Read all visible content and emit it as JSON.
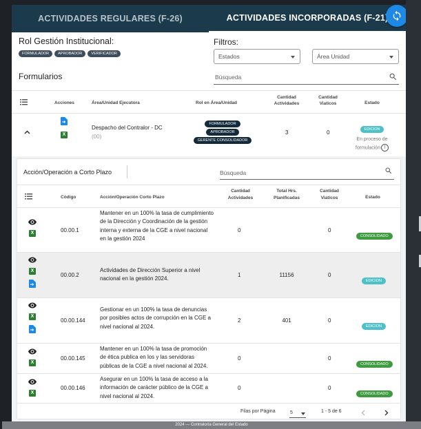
{
  "tabs": {
    "regular": "ACTIVIDADES REGULARES (F-26)",
    "incorporated": "ACTIVIDADES INCORPORADAS (F-21)"
  },
  "rol": {
    "title": "Rol Gestión Institucional:",
    "chips": [
      "FORMULADOR",
      "APROBADOR",
      "VERIFICADOR"
    ]
  },
  "formularios_label": "Formularios",
  "filtros": {
    "title": "Filtros:",
    "estados_placeholder": "Estados",
    "area_placeholder": "Área Unidad",
    "search_placeholder": "Búsqueda"
  },
  "table1": {
    "headers": {
      "acciones": "Acciones",
      "area": "Área/Unidad Ejecutora",
      "rol": "Rol en Área/Unidad",
      "cant_act_1": "Cantidad",
      "cant_act_2": "Actividades",
      "cant_via_1": "Cantidad",
      "cant_via_2": "Viaticos",
      "estado": "Estado"
    },
    "row": {
      "area": "Despacho del Contralor - DC",
      "code": "(00)",
      "roles": [
        "FORMULADOR",
        "APROBADOR",
        "GERENTE CONSOLIDADOR"
      ],
      "cantidad_actividades": "3",
      "cantidad_viaticos": "0",
      "estado_badge": "EDICION",
      "estado_line1": "En proceso de",
      "estado_line2": "formulación"
    }
  },
  "subpanel": {
    "title": "Acción/Operación a Corto Plazo",
    "search_placeholder": "Búsqueda",
    "headers": {
      "codigo": "Código",
      "accion": "Acción/Operación Corto Plazo",
      "cant_act_1": "Cantidad",
      "cant_act_2": "Actividades",
      "hrs_1": "Total Hrs.",
      "hrs_2": "Planificadas",
      "via_1": "Cantidad",
      "via_2": "Viaticos",
      "estado": "Estado"
    },
    "rows": [
      {
        "code": "00.00.1",
        "desc": "Mantener en un 100% la tasa de cumplimiento de la Dirección y Coordinación de la gestión interna y externa de la CGE a nivel nacional en la gestión 2024",
        "act": "0",
        "hrs": "",
        "via": "0",
        "estado": "CONSOLIDADO"
      },
      {
        "code": "00.00.2",
        "desc": "Actividades de Dirección Superior a nivel nacional en la gestión 2024.",
        "act": "1",
        "hrs": "11156",
        "via": "0",
        "estado": "EDICION"
      },
      {
        "code": "00.00.144",
        "desc": "Gestionar en un 100% la tasa de denuncias por posibles actos de corrupción en la CGE a nivel nacional al 2024.",
        "act": "2",
        "hrs": "401",
        "via": "0",
        "estado": "EDICION"
      },
      {
        "code": "00.00.145",
        "desc": "Mantener en un 100% la tasa de promoción de ética publica en los y las servidoras públicas de la CGE a nivel nacional al 2024.",
        "act": "0",
        "hrs": "",
        "via": "0",
        "estado": "CONSOLIDADO"
      },
      {
        "code": "00.00.146",
        "desc": "Asegurar en un 100% la tasa de acceso a la información de carácter público de la CGE a nivel nacional al 2024.",
        "act": "0",
        "hrs": "",
        "via": "0",
        "estado": "CONSOLIDADO"
      }
    ],
    "pagination": {
      "rows_label": "Filas por Página",
      "rows_value": "5",
      "range": "1 - 5 de 6"
    }
  },
  "footer": "2024 — Contraloría General del Estado",
  "colors": {
    "header": "#1b3a4b",
    "accent": "#1e88e5",
    "edicion": "#4ec1c8",
    "consolidado": "#3f9b3f"
  },
  "icons": [
    "sync-icon",
    "filter-list-icon",
    "search-icon",
    "chevron-up-icon",
    "document-arrow-icon",
    "excel-icon",
    "eye-icon",
    "chevron-left-icon",
    "chevron-right-icon",
    "info-icon"
  ]
}
